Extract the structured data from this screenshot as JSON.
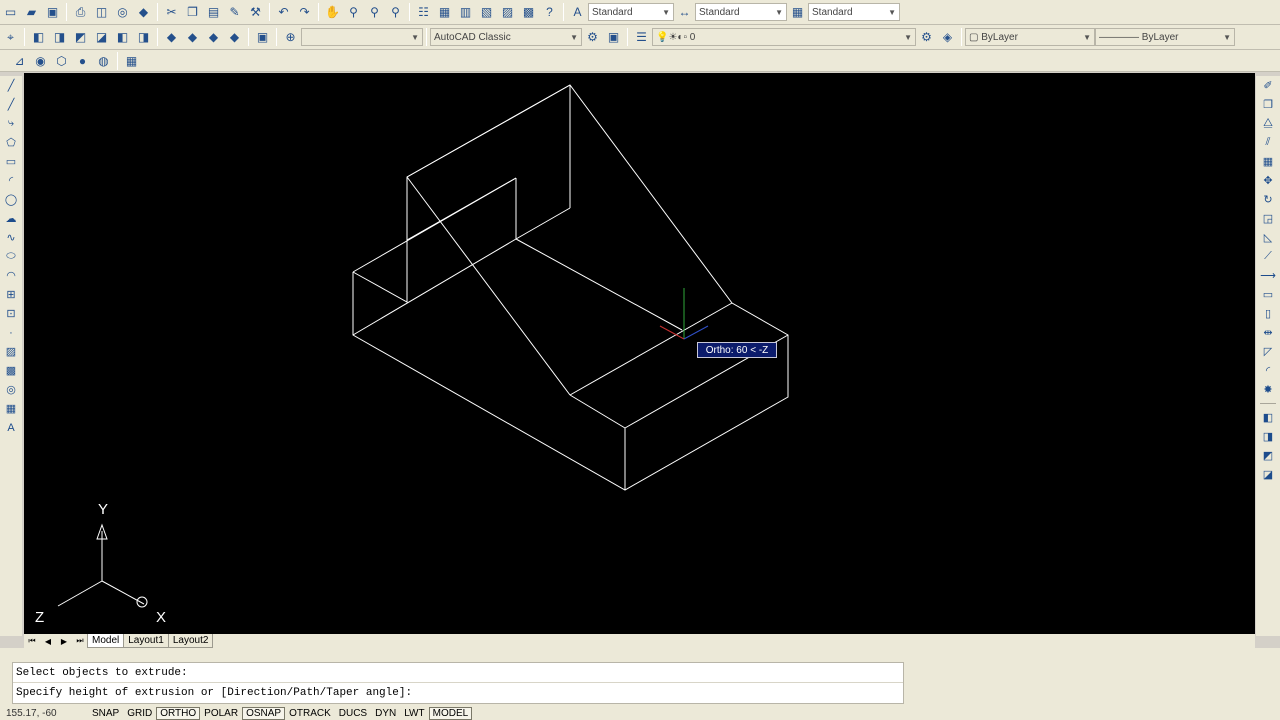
{
  "toolbar_top": {
    "text_style": "Standard",
    "dim_style": "Standard",
    "table_style": "Standard"
  },
  "toolbar_workspace": {
    "workspace": "AutoCAD Classic",
    "layer": "0",
    "color": "ByLayer",
    "linetype": "ByLayer"
  },
  "canvas": {
    "ortho_tooltip": "Ortho: 60 < -Z",
    "ucs": {
      "y": "Y",
      "x": "X",
      "z": "Z"
    }
  },
  "tabs": {
    "model": "Model",
    "layout1": "Layout1",
    "layout2": "Layout2"
  },
  "command": {
    "history": "Select objects to extrude:",
    "prompt": "Specify height of extrusion or [Direction/Path/Taper angle]:"
  },
  "status": {
    "coords": "155.17, -60",
    "snap": "SNAP",
    "grid": "GRID",
    "ortho": "ORTHO",
    "polar": "POLAR",
    "osnap": "OSNAP",
    "otrack": "OTRACK",
    "ducs": "DUCS",
    "dyn": "DYN",
    "lwt": "LWT",
    "model": "MODEL"
  },
  "colors": {
    "canvas_bg": "#000000",
    "wireframe": "#ffffff",
    "tooltip_bg": "#0b1b6b",
    "ui_bg": "#ece9d8"
  }
}
